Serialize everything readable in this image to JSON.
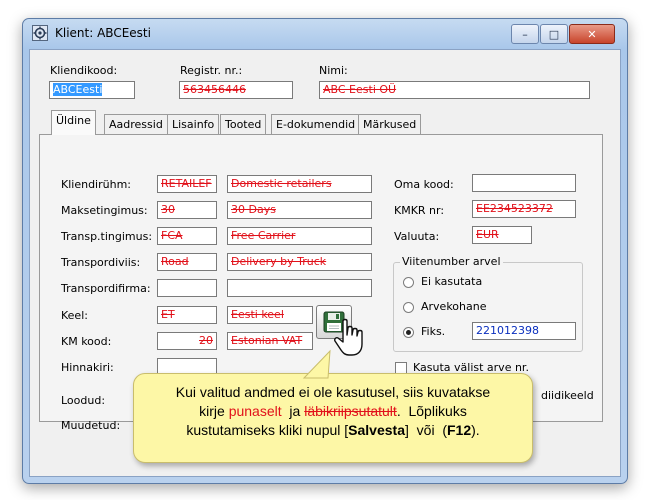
{
  "window": {
    "title": "Klient: ABCEesti",
    "controls": {
      "minimize": "–",
      "maximize": "□",
      "close": "✕"
    }
  },
  "header": {
    "kliendikood": {
      "label": "Kliendikood:",
      "value": "ABCEesti"
    },
    "registr": {
      "label": "Registr. nr.:",
      "value": "563456446"
    },
    "nimi": {
      "label": "Nimi:",
      "value": "ABC Eesti OÜ"
    }
  },
  "tabs": [
    "Üldine",
    "Aadressid",
    "Lisainfo",
    "Tooted",
    "E-dokumendid",
    "Märkused"
  ],
  "form": {
    "kliendiruhm": {
      "label": "Kliendirühm:",
      "code": "RETAILEF",
      "desc": "Domestic retailers"
    },
    "maksetingimus": {
      "label": "Maksetingimus:",
      "code": "30",
      "desc": "30 Days"
    },
    "transp_tingimus": {
      "label": "Transp.tingimus:",
      "code": "FCA",
      "desc": "Free Carrier"
    },
    "transpordiviis": {
      "label": "Transpordiviis:",
      "code": "Road",
      "desc": "Delivery by Truck"
    },
    "transpordifirma": {
      "label": "Transpordifirma:",
      "code": "",
      "desc": ""
    },
    "keel": {
      "label": "Keel:",
      "code": "ET",
      "desc": "Eesti keel"
    },
    "km_kood": {
      "label": "KM kood:",
      "code": "20",
      "desc": "Estonian VAT"
    },
    "hinnakiri": {
      "label": "Hinnakiri:",
      "code": "",
      "desc": ""
    },
    "loodud": {
      "label": "Loodud:"
    },
    "muudetud": {
      "label": "Muudetud:"
    }
  },
  "right": {
    "oma_kood": {
      "label": "Oma kood:",
      "value": ""
    },
    "kmkr": {
      "label": "KMKR nr:",
      "value": "EE234523372"
    },
    "valuuta": {
      "label": "Valuuta:",
      "value": "EUR"
    },
    "viitenumber": {
      "title": "Viitenumber arvel",
      "options": [
        "Ei kasutata",
        "Arvekohane",
        "Fiks."
      ],
      "selected": "Fiks.",
      "fiks_value": "221012398"
    },
    "kasuta_valist": {
      "label": "Kasuta välist arve nr.",
      "checked": false
    },
    "partial_label": "diidikeeld"
  },
  "tooltip": {
    "line1": "Kui valitud andmed ei ole kasutusel, siis kuvatakse",
    "l2_a": "kirje ",
    "l2_red": "punaselt",
    "l2_b": "  ja ",
    "l2_strike": "läbikriipsutatult",
    "l2_c": ".  Lõplikuks",
    "l3_a": "kustutamiseks kliki nupul [",
    "l3_bold": "Salvesta",
    "l3_b": "]  või  (",
    "l3_key": "F12",
    "l3_c": ")."
  },
  "colors": {
    "inactive_red": "#e1111a",
    "value_blue": "#0a2fbe",
    "tooltip_bg": "#fdf7a6",
    "selection": "#3399ff"
  },
  "icons": {
    "app": "client-app-icon",
    "save": "floppy-disk-icon",
    "cursor": "hand-pointer-icon"
  }
}
